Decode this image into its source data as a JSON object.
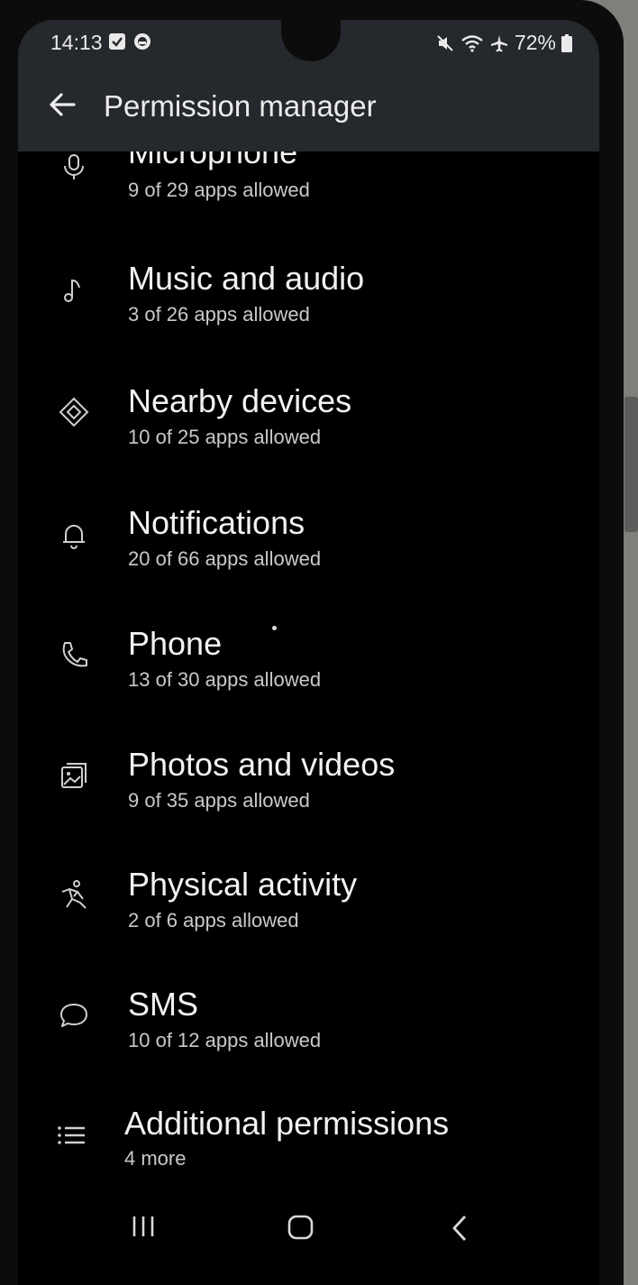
{
  "status_bar": {
    "time": "14:13",
    "battery": "72%"
  },
  "header": {
    "title": "Permission manager"
  },
  "permissions": [
    {
      "label": "Microphone",
      "summary": "9 of 29 apps allowed",
      "icon": "microphone-icon"
    },
    {
      "label": "Music and audio",
      "summary": "3 of 26 apps allowed",
      "icon": "music-note-icon"
    },
    {
      "label": "Nearby devices",
      "summary": "10 of 25 apps allowed",
      "icon": "nearby-devices-icon"
    },
    {
      "label": "Notifications",
      "summary": "20 of 66 apps allowed",
      "icon": "bell-icon"
    },
    {
      "label": "Phone",
      "summary": "13 of 30 apps allowed",
      "icon": "phone-icon"
    },
    {
      "label": "Photos and videos",
      "summary": "9 of 35 apps allowed",
      "icon": "photos-icon"
    },
    {
      "label": "Physical activity",
      "summary": "2 of 6 apps allowed",
      "icon": "running-icon"
    },
    {
      "label": "SMS",
      "summary": "10 of 12 apps allowed",
      "icon": "chat-bubble-icon"
    },
    {
      "label": "Additional permissions",
      "summary": "4 more",
      "icon": "list-icon"
    }
  ],
  "colors": {
    "header_bg": "#25282c",
    "background": "#000000",
    "text": "#f2f2f2",
    "subtext": "#c9c9c9"
  }
}
